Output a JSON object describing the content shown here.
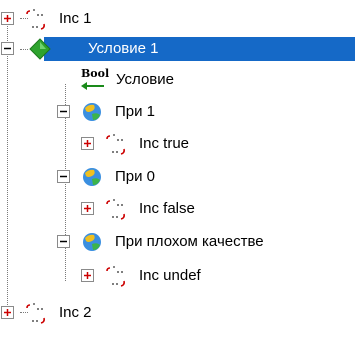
{
  "tree": {
    "items": [
      {
        "label": "Inc 1",
        "expander": "plus",
        "icon": "block-icon"
      },
      {
        "label": "Условие 1",
        "expander": "minus",
        "icon": "condition-diamond-icon",
        "selected": true
      },
      {
        "label": "Условие",
        "expander": "none",
        "icon": "bool-icon",
        "icon_text": "Bool"
      },
      {
        "label": "При 1",
        "expander": "minus",
        "icon": "globe-icon"
      },
      {
        "label": "Inc true",
        "expander": "plus",
        "icon": "block-icon"
      },
      {
        "label": "При 0",
        "expander": "minus",
        "icon": "globe-icon"
      },
      {
        "label": "Inc false",
        "expander": "plus",
        "icon": "block-icon"
      },
      {
        "label": "При плохом качестве",
        "expander": "minus",
        "icon": "globe-icon"
      },
      {
        "label": "Inc undef",
        "expander": "plus",
        "icon": "block-icon"
      },
      {
        "label": "Inc 2",
        "expander": "plus",
        "icon": "block-icon"
      }
    ]
  },
  "colors": {
    "selection": "#1569c7",
    "plus_sign": "#cc0000",
    "minus_sign": "#000000",
    "diamond": "#2ea32e",
    "bool_arrow": "#1a8a1a"
  }
}
